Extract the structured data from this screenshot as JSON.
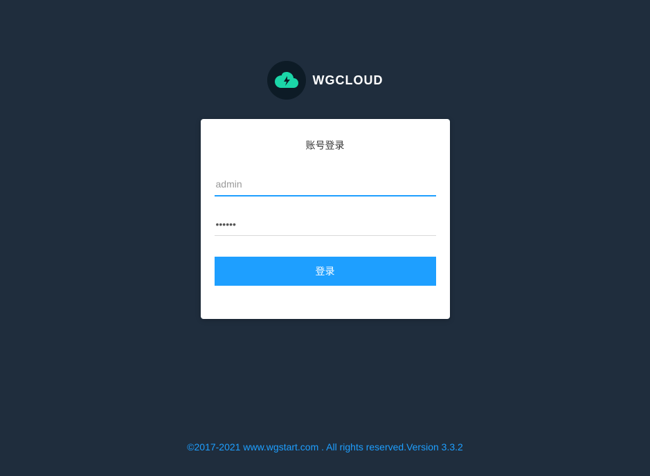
{
  "brand": {
    "name": "WGCLOUD"
  },
  "login": {
    "title": "账号登录",
    "username_placeholder": "admin",
    "username_value": "",
    "password_value": "••••••",
    "button_label": "登录"
  },
  "footer": {
    "text": "©2017-2021 www.wgstart.com . All rights reserved.Version 3.3.2"
  },
  "colors": {
    "background": "#1f2d3d",
    "primary": "#1e9fff",
    "cloud": "#1bd6a8"
  }
}
